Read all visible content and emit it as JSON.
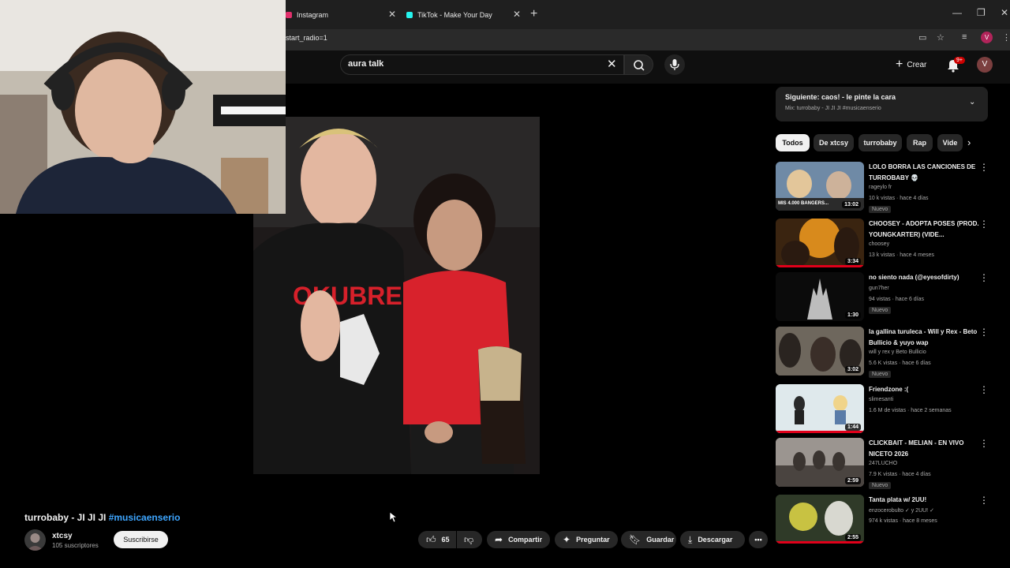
{
  "browser": {
    "tabs": [
      {
        "label": "Instagram"
      },
      {
        "label": "TikTok - Make Your Day"
      }
    ],
    "url": "start_radio=1",
    "profile_initial": "V"
  },
  "header": {
    "search_query": "aura talk",
    "create_label": "Crear",
    "notifications_badge": "9+",
    "avatar_initial": "V"
  },
  "video": {
    "title_main": "turrobaby - JI JI JI ",
    "title_hashtag": "#musicaenserio",
    "channel_name": "xtcsy",
    "channel_subs": "105 suscriptores",
    "subscribe_label": "Suscribirse",
    "likes": "65",
    "share_label": "Compartir",
    "ask_label": "Preguntar",
    "save_label": "Guardar",
    "download_label": "Descargar"
  },
  "sidebar": {
    "next_title": "Siguiente: caos! - le pinte la cara",
    "next_sub": "Mix: turrobaby - JI JI JI #musicaenserio",
    "chips": [
      "Todos",
      "De xtcsy",
      "turrobaby",
      "Rap",
      "Vide"
    ],
    "recommendations": [
      {
        "title": "LOLO BORRA LAS CANCIONES DE TURROBABY 💀",
        "channel": "rageylo fr",
        "meta": "10 k vistas · hace 4 días",
        "badge": "Nuevo",
        "duration": "13:02",
        "thumb_text": "MIS 4.000 BANGERS..."
      },
      {
        "title": "CHOOSEY - ADOPTA POSES (PROD. YOUNGKARTER) (VIDE...",
        "channel": "choosey",
        "meta": "13 k vistas · hace 4 meses",
        "badge": "",
        "duration": "3:34",
        "thumb_text": ""
      },
      {
        "title": "no siento nada (@eyesofdirty)",
        "channel": "gun7her",
        "meta": "94 vistas · hace 6 días",
        "badge": "Nuevo",
        "duration": "1:30",
        "thumb_text": ""
      },
      {
        "title": "la gallina turuleca - Will y Rex - Beto Bullicio & yuyo wap",
        "channel": "will y rex y Beto Bullicio",
        "meta": "5.6 K vistas · hace 6 días",
        "badge": "Nuevo",
        "duration": "3:02",
        "thumb_text": ""
      },
      {
        "title": "Friendzone :(",
        "channel": "slimesanti",
        "meta": "1.6 M de vistas · hace 2 semanas",
        "badge": "",
        "duration": "1:44",
        "thumb_text": ""
      },
      {
        "title": "CLICKBAIT - MELIAN - EN VIVO NICETO 2026",
        "channel": "247LUCHO",
        "meta": "7.9 K vistas · hace 4 días",
        "badge": "Nuevo",
        "duration": "2:59",
        "thumb_text": ""
      },
      {
        "title": "Tanta plata w/ 2UU!",
        "channel": "enzocerobulto ✓ y 2UU! ✓",
        "meta": "974 k vistas · hace 8 meses",
        "badge": "",
        "duration": "2:55",
        "thumb_text": ""
      }
    ]
  },
  "artwork_text": "OKUBRE",
  "colors": {
    "background": "#0f0f0f",
    "accent_red": "#e0001a",
    "link_blue": "#3ea6ff"
  }
}
